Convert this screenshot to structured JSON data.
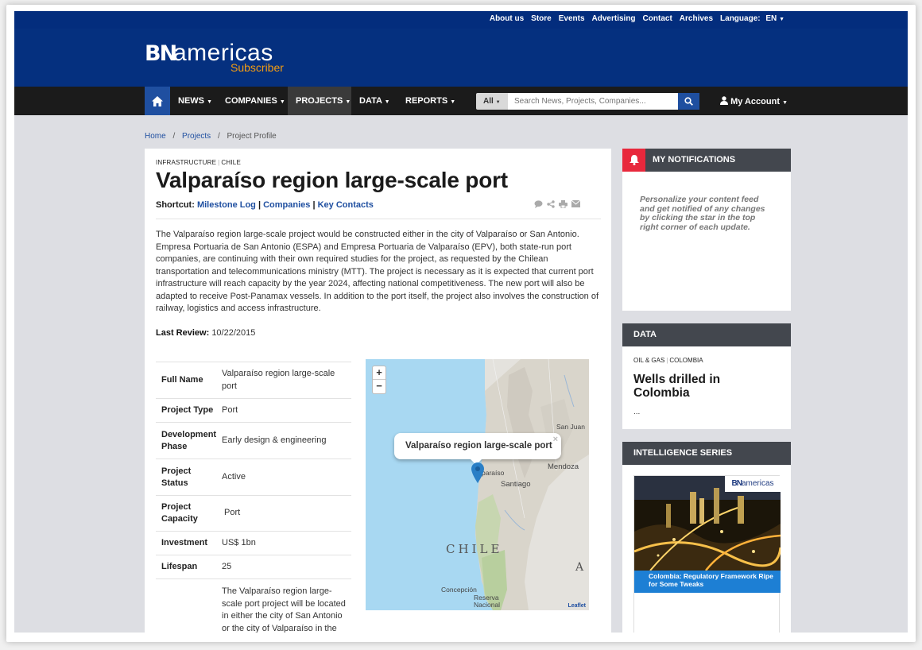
{
  "topbar": {
    "links": [
      "About us",
      "Store",
      "Events",
      "Advertising",
      "Contact",
      "Archives"
    ],
    "language_label": "Language:",
    "language_value": "EN"
  },
  "header": {
    "logo_mark": "BN",
    "logo_word": "americas",
    "logo_sub": "Subscriber"
  },
  "nav": {
    "items": [
      "NEWS",
      "COMPANIES",
      "PROJECTS",
      "DATA",
      "REPORTS"
    ],
    "active": "PROJECTS",
    "search_scope": "All",
    "search_placeholder": "Search News, Projects, Companies...",
    "account_label": "My Account"
  },
  "breadcrumb": {
    "home": "Home",
    "projects": "Projects",
    "current": "Project Profile",
    "separator": "/"
  },
  "project": {
    "tag_sector": "INFRASTRUCTURE",
    "tag_country": "CHILE",
    "title": "Valparaíso region large-scale port",
    "shortcut_label": "Shortcut:",
    "shortcut_links": [
      "Milestone Log",
      "Companies",
      "Key Contacts"
    ],
    "description": "The Valparaíso region large-scale project would be constructed either in the city of Valparaíso or San Antonio. Empresa Portuaria de San Antonio (ESPA) and Empresa Portuaria de Valparaíso (EPV), both state-run port companies, are continuing with their own required studies for the project, as requested by the Chilean transportation and telecommunications ministry (MTT). The project is necessary as it is expected that current port infrastructure will reach capacity by the year 2024, affecting national competitiveness. The new port will also be adapted to receive Post-Panamax vessels. In addition to the port itself, the project also involves the construction of railway, logistics and access infrastructure.",
    "last_review_label": "Last Review:",
    "last_review_value": "10/22/2015",
    "facts": [
      {
        "key": "Full Name",
        "value": "Valparaíso region large-scale port"
      },
      {
        "key": "Project Type",
        "value": "Port"
      },
      {
        "key": "Development Phase",
        "value": "Early design & engineering"
      },
      {
        "key": "Project Status",
        "value": "Active"
      },
      {
        "key": "Project Capacity",
        "value": "Port"
      },
      {
        "key": "Investment",
        "value": "US$ 1bn"
      },
      {
        "key": "Lifespan",
        "value": "25"
      },
      {
        "key": "",
        "value": "The Valparaíso region large-scale port project will be located in either the city of San Antonio or the city of Valparaíso in the Chilean"
      }
    ]
  },
  "map": {
    "zoom_in": "+",
    "zoom_out": "−",
    "popup_title": "Valparaíso region large-scale port",
    "popup_close": "×",
    "labels": {
      "san_juan": "San Juan",
      "mendoza": "Mendoza",
      "paraiso": "paraíso",
      "santiago": "Santiago",
      "chile": "CHILE",
      "a": "A",
      "concepcion": "Concepción",
      "reserva": "Reserva",
      "nacional": "Nacional"
    },
    "attribution": "Leaflet"
  },
  "sidebar": {
    "notifications": {
      "title": "MY NOTIFICATIONS",
      "text": "Personalize your content feed and get notified of any changes by clicking the star in the top right corner of each update."
    },
    "data": {
      "title": "DATA",
      "tag_sector": "OIL & GAS",
      "tag_country": "COLOMBIA",
      "headline": "Wells drilled in Colombia",
      "ellipsis": "..."
    },
    "intelligence": {
      "title": "INTELLIGENCE SERIES",
      "logo": "americas",
      "caption": "Colombia: Regulatory Framework Ripe for Some Tweaks"
    }
  }
}
